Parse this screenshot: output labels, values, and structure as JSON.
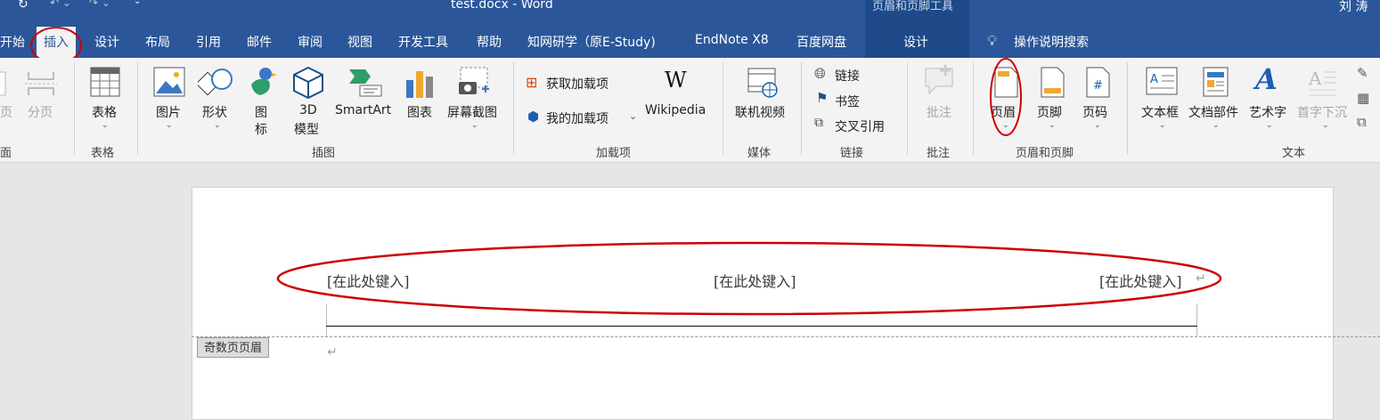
{
  "titlebar": {
    "doc_title": "test.docx  -  Word",
    "context_tools": "页眉和页脚工具",
    "user": "刘 涛"
  },
  "tabs": [
    "开始",
    "插入",
    "设计",
    "布局",
    "引用",
    "邮件",
    "审阅",
    "视图",
    "开发工具",
    "帮助",
    "知网研学（原E-Study)",
    "EndNote X8",
    "百度网盘",
    "设计"
  ],
  "search": {
    "label": "操作说明搜索"
  },
  "ribbon": {
    "pages": {
      "break_label": "页",
      "pagebreak_label": "分页",
      "group": "面"
    },
    "tables": {
      "table_label": "表格",
      "group": "表格"
    },
    "illustrations": {
      "picture": "图片",
      "shapes": "形状",
      "icons_line1": "图",
      "icons_line2": "标",
      "model_line1": "3D",
      "model_line2": "模型",
      "smartart": "SmartArt",
      "chart": "图表",
      "screenshot": "屏幕截图",
      "group": "插图"
    },
    "addins": {
      "get": "获取加载项",
      "my": "我的加载项",
      "wikipedia": "Wikipedia",
      "group": "加载项"
    },
    "media": {
      "video": "联机视频",
      "group": "媒体"
    },
    "links": {
      "link": "链接",
      "bookmark": "书签",
      "crossref": "交叉引用",
      "group": "链接"
    },
    "comments": {
      "comment": "批注",
      "group": "批注"
    },
    "header_footer": {
      "header": "页眉",
      "footer": "页脚",
      "page_number": "页码",
      "group": "页眉和页脚"
    },
    "text": {
      "textbox": "文本框",
      "quickparts": "文档部件",
      "wordart": "艺术字",
      "dropcap": "首字下沉",
      "group": "文本"
    }
  },
  "document": {
    "placeholder_left": "[在此处键入]",
    "placeholder_center": "[在此处键入]",
    "placeholder_right": "[在此处键入]",
    "header_label": "奇数页页眉",
    "paragraph_mark": "↵"
  },
  "colors": {
    "accent": "#2b579a",
    "annotation": "#cc0000"
  }
}
